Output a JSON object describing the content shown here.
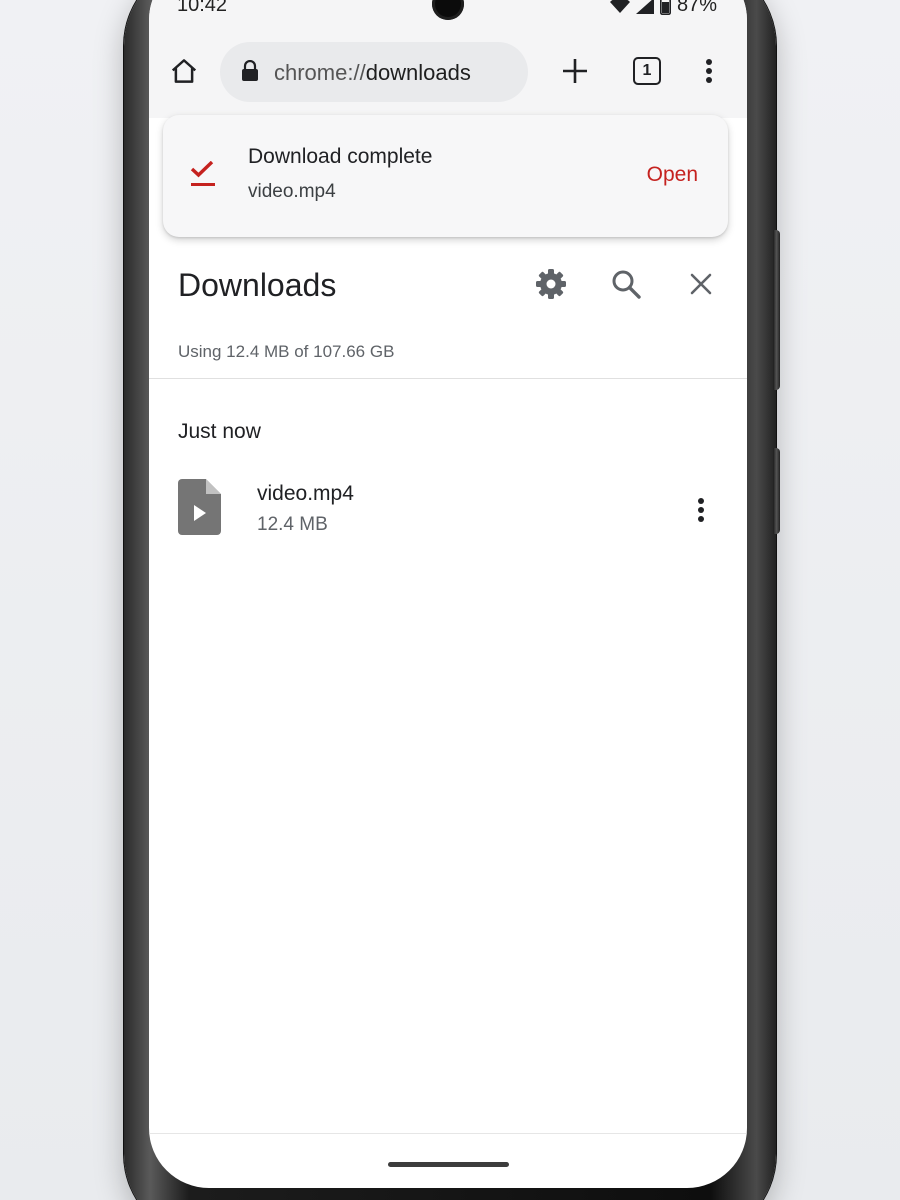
{
  "status_bar": {
    "time": "10:42",
    "battery": "87%",
    "icons": [
      "wifi-icon",
      "signal-icon",
      "battery-icon"
    ]
  },
  "toolbar": {
    "url_scheme": "chrome://",
    "url_host": "downloads",
    "tab_count": "1",
    "icons": [
      "home-icon",
      "lock-icon",
      "new-tab-icon",
      "tab-switcher-icon",
      "overflow-menu-icon"
    ]
  },
  "message": {
    "title": "Download complete",
    "filename": "video.mp4",
    "action": "Open",
    "icon": "download-done-icon",
    "accent_color": "#c5221f"
  },
  "page": {
    "title": "Downloads",
    "storage": "Using 12.4 MB of 107.66 GB",
    "header_icons": [
      "settings-icon",
      "search-icon",
      "close-icon"
    ]
  },
  "downloads": {
    "sections": [
      {
        "label": "Just now",
        "items": [
          {
            "name": "video.mp4",
            "size": "12.4 MB",
            "icon": "video-file-icon"
          }
        ]
      }
    ]
  }
}
